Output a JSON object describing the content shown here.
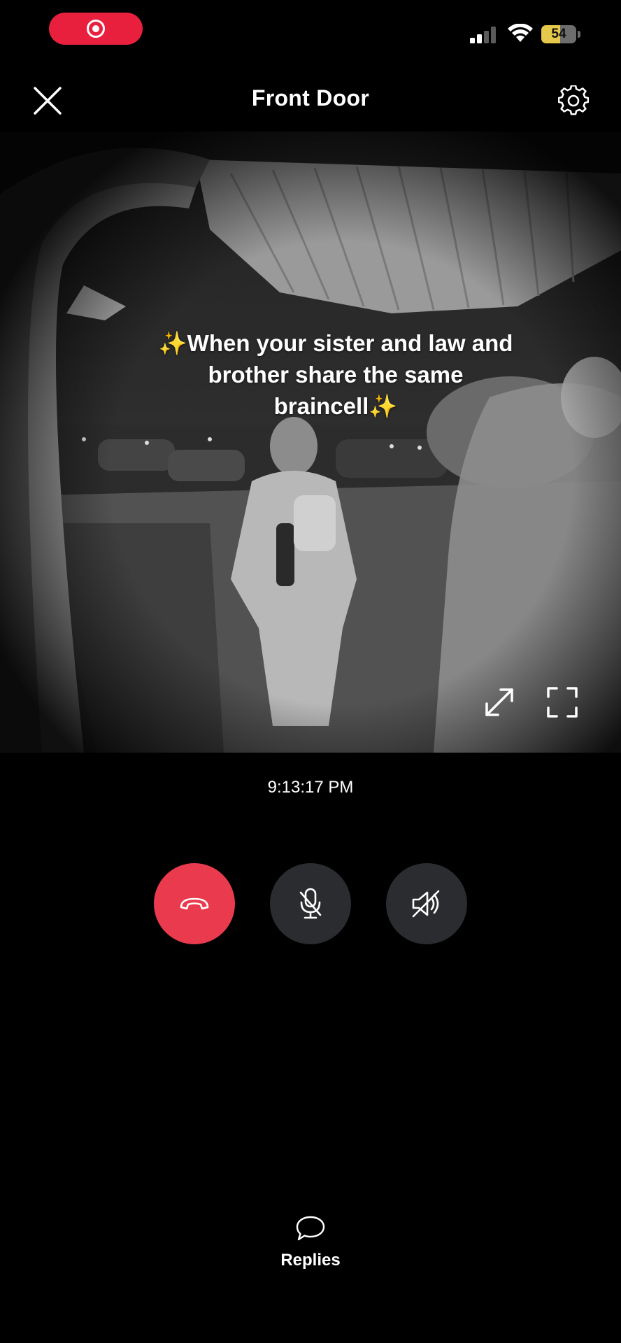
{
  "status_bar": {
    "battery_level": "54",
    "battery_fraction": 0.54,
    "recording_icon": "screen-record-icon",
    "signal_icon": "cellular-signal-icon",
    "wifi_icon": "wifi-icon"
  },
  "header": {
    "title": "Front Door",
    "close_icon": "close-icon",
    "settings_icon": "gear-icon"
  },
  "video": {
    "caption": "✨When your sister and law and brother share the same braincell✨",
    "expand_icon": "expand-arrows-icon",
    "fullscreen_icon": "fullscreen-frame-icon"
  },
  "timestamp": "9:13:17 PM",
  "controls": {
    "hangup_icon": "hang-up-phone-icon",
    "mic_icon": "microphone-muted-icon",
    "speaker_icon": "speaker-muted-icon"
  },
  "replies": {
    "label": "Replies",
    "icon": "speech-bubble-icon"
  },
  "colors": {
    "accent": "#e8203e",
    "hangup": "#ea3a4e",
    "control_bg": "#2a2c2f",
    "background": "#000000",
    "battery_fill": "#e6c84a"
  }
}
